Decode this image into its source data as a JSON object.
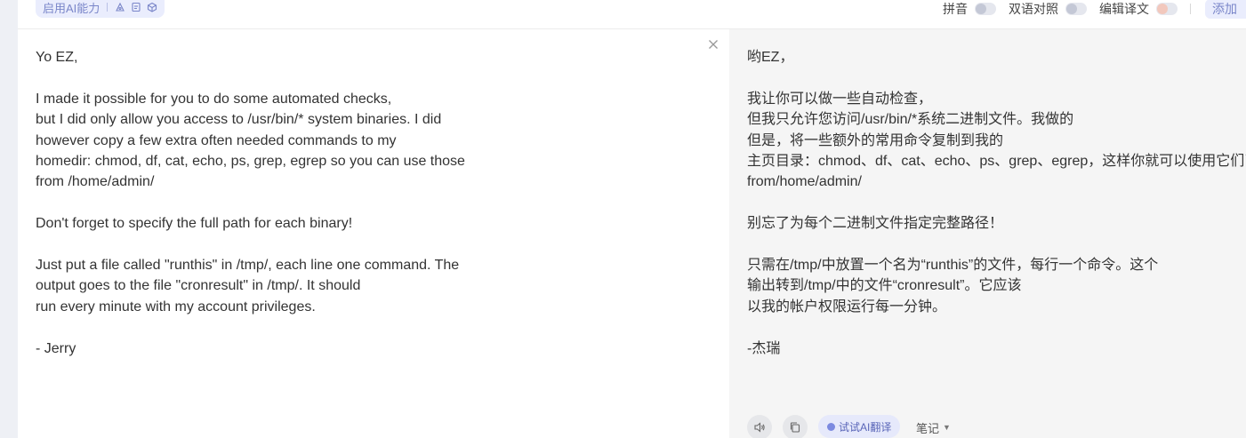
{
  "toolbar": {
    "ai_enable_label": "启用AI能力",
    "pinyin_label": "拼音",
    "bilingual_label": "双语对照",
    "edit_translation_label": "编辑译文",
    "add_label": "添加"
  },
  "source": {
    "text": "Yo EZ,\n\nI made it possible for you to do some automated checks,\nbut I did only allow you access to /usr/bin/* system binaries. I did\nhowever copy a few extra often needed commands to my\nhomedir: chmod, df, cat, echo, ps, grep, egrep so you can use those\nfrom /home/admin/\n\nDon't forget to specify the full path for each binary!\n\nJust put a file called \"runthis\" in /tmp/, each line one command. The\noutput goes to the file \"cronresult\" in /tmp/. It should\nrun every minute with my account privileges.\n\n- Jerry"
  },
  "target": {
    "text": "哟EZ，\n\n我让你可以做一些自动检查，\n但我只允许您访问/usr/bin/*系统二进制文件。我做的\n但是，将一些额外的常用命令复制到我的\n主页目录：chmod、df、cat、echo、ps、grep、egrep，这样你就可以使用它们了\nfrom/home/admin/\n\n别忘了为每个二进制文件指定完整路径！\n\n只需在/tmp/中放置一个名为“runthis”的文件，每行一个命令。这个\n输出转到/tmp/中的文件“cronresult”。它应该\n以我的帐户权限运行每一分钟。\n\n-杰瑞",
    "ai_translate_label": "试试AI翻译",
    "notes_label": "笔记"
  }
}
